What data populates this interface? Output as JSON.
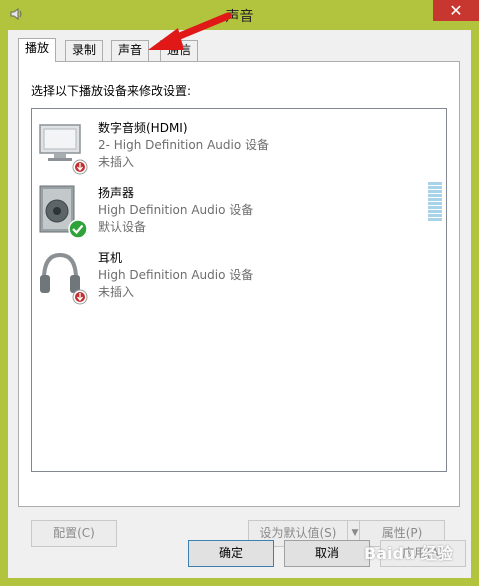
{
  "window": {
    "title": "声音",
    "close_glyph": "✕",
    "frame_color": "#b2c43e",
    "close_color": "#c7372f"
  },
  "tabs": [
    {
      "label": "播放",
      "active": true
    },
    {
      "label": "录制",
      "active": false
    },
    {
      "label": "声音",
      "active": false
    },
    {
      "label": "通信",
      "active": false
    }
  ],
  "panel": {
    "instruction": "选择以下播放设备来修改设置:"
  },
  "devices": [
    {
      "name": "数字音频(HDMI)",
      "description": "2- High Definition Audio 设备",
      "status": "未插入",
      "icon": "monitor-icon",
      "badge": "unplugged-badge-icon"
    },
    {
      "name": "扬声器",
      "description": "High Definition Audio 设备",
      "status": "默认设备",
      "icon": "speaker-icon",
      "badge": "default-check-icon"
    },
    {
      "name": "耳机",
      "description": "High Definition Audio 设备",
      "status": "未插入",
      "icon": "headphones-icon",
      "badge": "unplugged-badge-icon"
    }
  ],
  "buttons": {
    "configure": "配置(C)",
    "set_default": "设为默认值(S)",
    "set_default_arrow": "▼",
    "properties": "属性(P)",
    "ok": "确定",
    "cancel": "取消",
    "apply": "应用(A)"
  },
  "watermark": "Baidu 经验"
}
